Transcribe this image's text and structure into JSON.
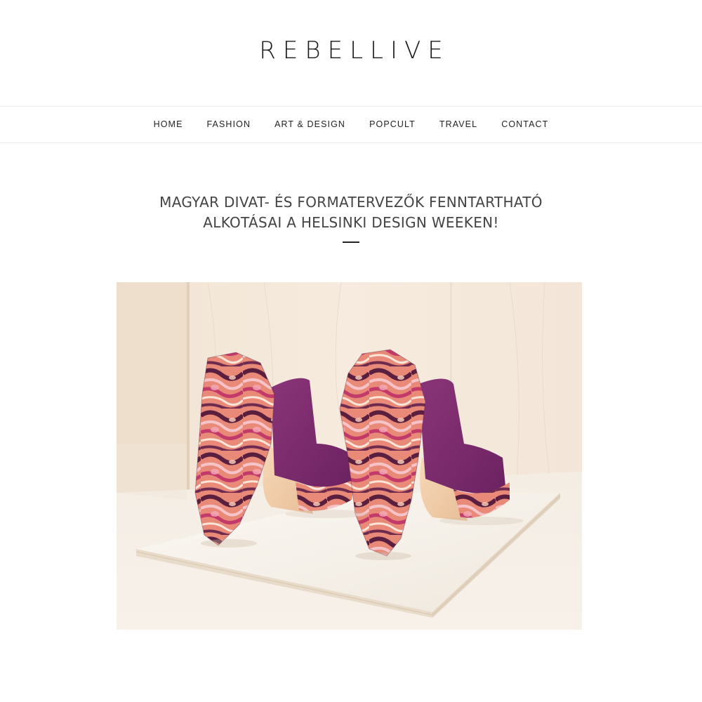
{
  "site": {
    "logo": "REBELLIVE"
  },
  "nav": {
    "items": [
      {
        "label": "HOME"
      },
      {
        "label": "FASHION"
      },
      {
        "label": "ART & DESIGN"
      },
      {
        "label": "POPCULT"
      },
      {
        "label": "TRAVEL"
      },
      {
        "label": "CONTACT"
      }
    ]
  },
  "article": {
    "title_line1": "MAGYAR DIVAT- ÉS FORMATERVEZŐK FENNTARTHATÓ",
    "title_line2": "ALKOTÁSAI A HELSINKI DESIGN WEEKEN!"
  },
  "colors": {
    "background": "#ffffff",
    "text": "#222222",
    "title": "#444444",
    "divider": "#ececec",
    "shoe_purple": "#7b2a6b",
    "wood": "#efe2d2"
  }
}
